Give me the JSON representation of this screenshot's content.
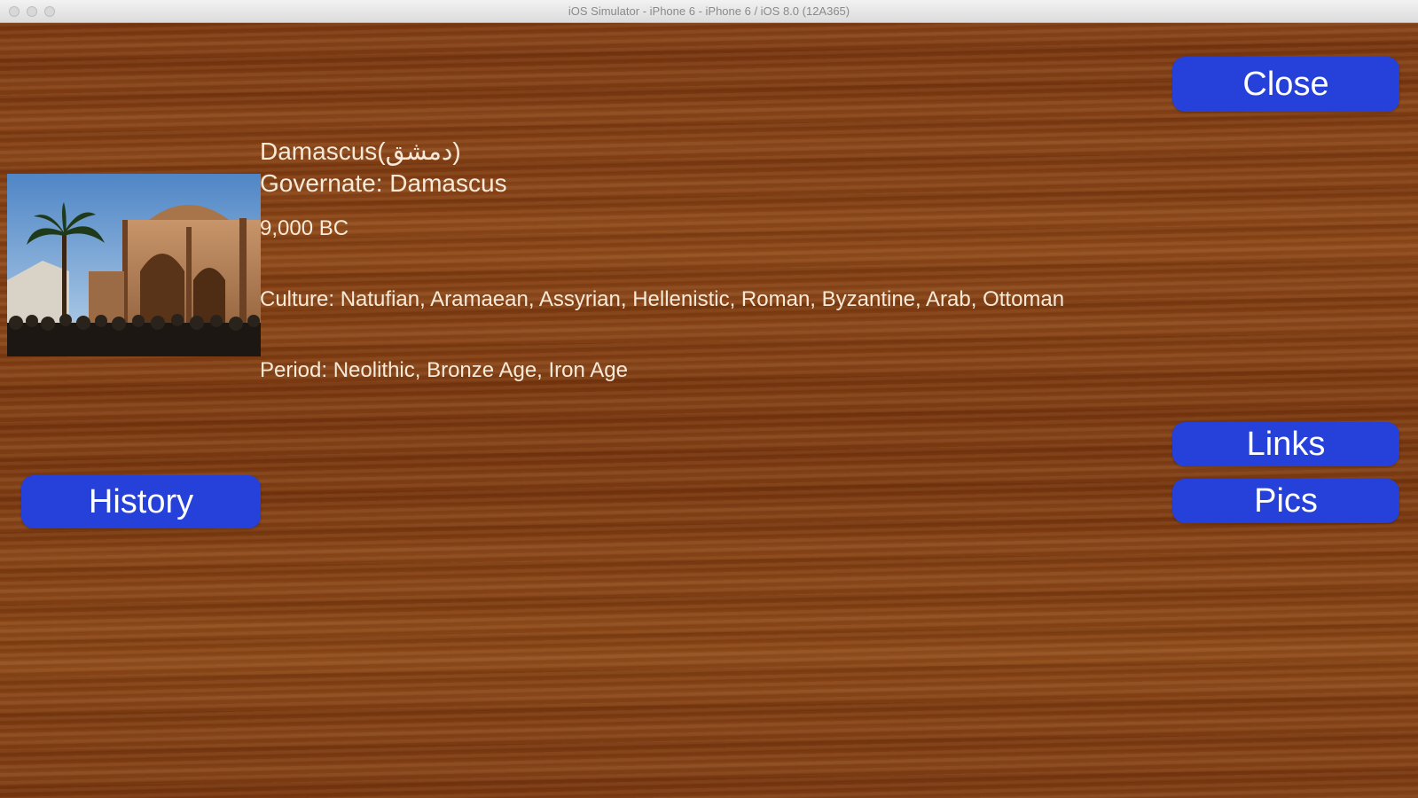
{
  "window": {
    "title": "iOS Simulator - iPhone 6 - iPhone 6 / iOS 8.0 (12A365)"
  },
  "buttons": {
    "close": "Close",
    "links": "Links",
    "pics": "Pics",
    "history": "History"
  },
  "site": {
    "name": "Damascus(دمشق)",
    "governate": "Governate: Damascus",
    "date": "9,000 BC",
    "culture": "Culture: Natufian, Aramaean, Assyrian, Hellenistic, Roman, Byzantine, Arab, Ottoman",
    "period": "Period: Neolithic, Bronze Age, Iron Age"
  },
  "colors": {
    "button": "#2541d9",
    "text": "#f7ead8",
    "wood": "#7d3a12"
  }
}
